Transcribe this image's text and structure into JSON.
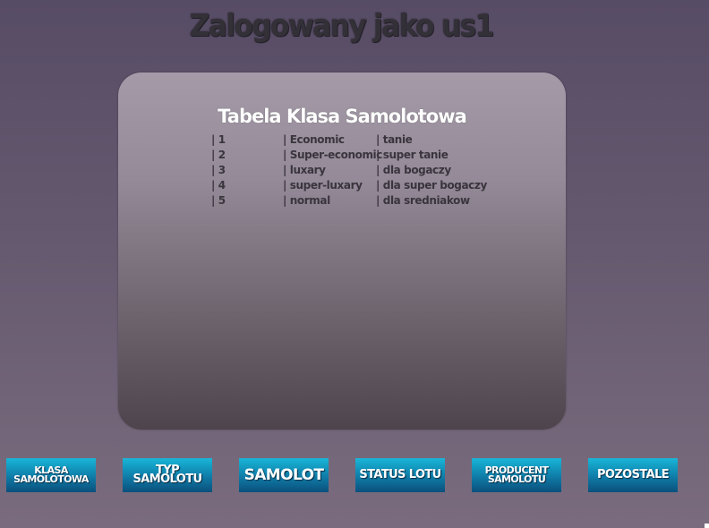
{
  "header": {
    "title": "Zalogowany jako us1"
  },
  "panel": {
    "title": "Tabela Klasa Samolotowa",
    "rows": [
      {
        "id": "| 1",
        "name": "| Economic",
        "desc": "| tanie"
      },
      {
        "id": "| 2",
        "name": "| Super-economic",
        "desc": "| super tanie"
      },
      {
        "id": "| 3",
        "name": "| luxary",
        "desc": "| dla bogaczy"
      },
      {
        "id": "| 4",
        "name": "| super-luxary",
        "desc": "| dla super bogaczy"
      },
      {
        "id": "| 5",
        "name": "| normal",
        "desc": "| dla sredniakow"
      }
    ]
  },
  "nav": {
    "klasa_line1": "KLASA",
    "klasa_line2": "SAMOLOTOWA",
    "typ": "TYP SAMOLOTU",
    "samolot": "SAMOLOT",
    "status": "STATUS LOTU",
    "producent_line1": "PRODUCENT",
    "producent_line2": "SAMOLOTU",
    "pozostale": "POZOSTALE"
  },
  "colors": {
    "button_top": "#19b6d8",
    "button_bottom": "#0b4f7c",
    "panel_top": "#a49aa8",
    "panel_bottom": "#4d444c"
  }
}
